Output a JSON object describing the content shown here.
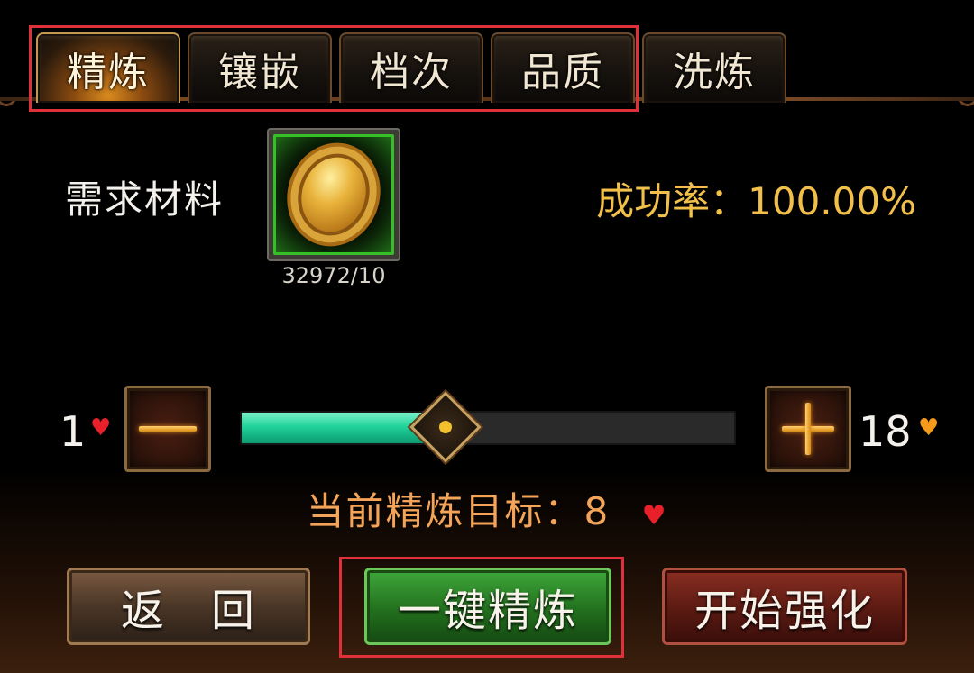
{
  "tabs": [
    {
      "label": "精炼",
      "active": true
    },
    {
      "label": "镶嵌",
      "active": false
    },
    {
      "label": "档次",
      "active": false
    },
    {
      "label": "品质",
      "active": false
    },
    {
      "label": "洗炼",
      "active": false
    }
  ],
  "material": {
    "label": "需求材料",
    "item_icon": "gold-coin-icon",
    "count": "32972/10"
  },
  "success_rate": "成功率：100.00%",
  "slider": {
    "min_label": "1",
    "max_label": "18",
    "min": 1,
    "max": 18,
    "value": 8,
    "fill_color": "#22d29a"
  },
  "target": {
    "text": "当前精炼目标：8"
  },
  "buttons": {
    "back": "返　回",
    "one_key": "一键精炼",
    "start": "开始强化"
  },
  "colors": {
    "success": "#f2c04a",
    "target": "#f4a458",
    "highlight": "#e0303a",
    "heart_red": "#e8202a",
    "heart_orange": "#f59a1a"
  }
}
